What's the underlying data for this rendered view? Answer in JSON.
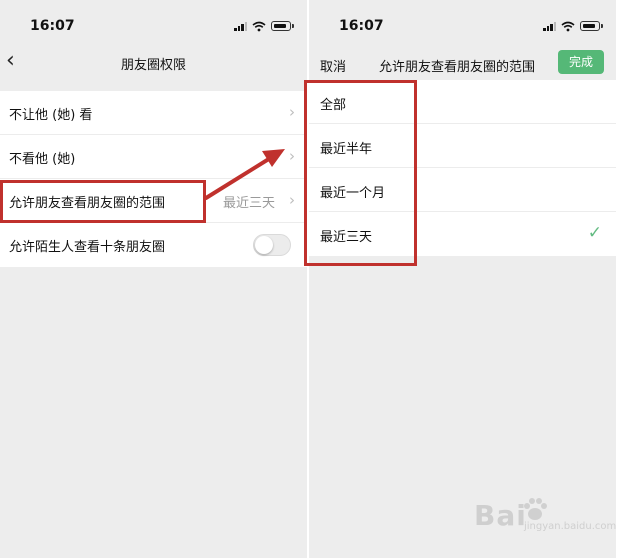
{
  "left_screen": {
    "status": {
      "time": "16:07"
    },
    "nav": {
      "title": "朋友圈权限"
    },
    "rows": [
      {
        "label": "不让他 (她) 看"
      },
      {
        "label": "不看他 (她)"
      },
      {
        "label": "允许朋友查看朋友圈的范围",
        "value": "最近三天"
      },
      {
        "label": "允许陌生人查看十条朋友圈",
        "toggle_on": false
      }
    ]
  },
  "right_screen": {
    "status": {
      "time": "16:07"
    },
    "nav": {
      "cancel_label": "取消",
      "title": "允许朋友查看朋友圈的范围",
      "done_label": "完成"
    },
    "options": [
      {
        "label": "全部",
        "selected": false
      },
      {
        "label": "最近半年",
        "selected": false
      },
      {
        "label": "最近一个月",
        "selected": false
      },
      {
        "label": "最近三天",
        "selected": true
      }
    ]
  },
  "colors": {
    "highlight": "#c0312d",
    "accent_green": "#55b877",
    "background": "#ededed"
  },
  "watermark": {
    "mark": "Bai",
    "sub": "jingyan.baidu.com"
  }
}
